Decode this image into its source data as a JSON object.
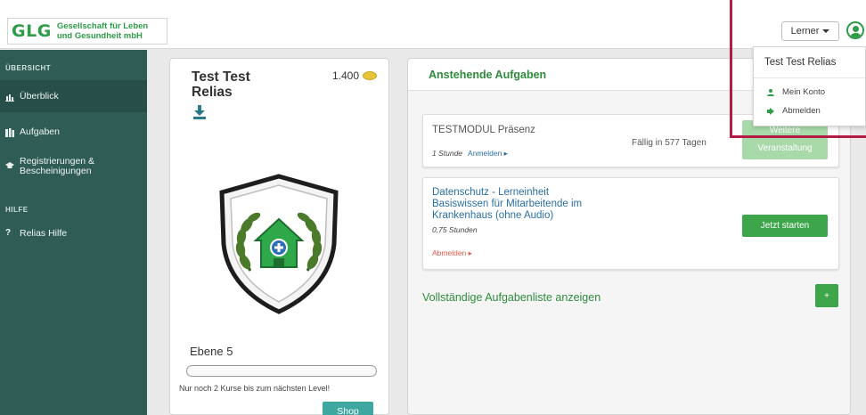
{
  "header": {
    "logo_mark": "GLG",
    "logo_line1": "Gesellschaft für Leben",
    "logo_line2": "und Gesundheit mbH",
    "role_button": "Lerner"
  },
  "sidebar": {
    "section_overview": "ÜBERSICHT",
    "items": [
      {
        "label": "Überblick",
        "icon": "bar-chart-icon"
      },
      {
        "label": "Aufgaben",
        "icon": "books-icon"
      },
      {
        "label_line1": "Registrierungen &",
        "label_line2": "Bescheinigungen",
        "icon": "graduation-cap-icon"
      }
    ],
    "section_help": "HILFE",
    "help_item": {
      "label": "Relias Hilfe",
      "icon": "question-icon"
    }
  },
  "profile_card": {
    "name_line1": "Test Test",
    "name_line2": "Relias",
    "points": "1.400",
    "level": "Ebene 5",
    "progress_fraction": 0,
    "hint": "Nur noch 2 Kurse bis zum nächsten Level!",
    "shop_button": "Shop"
  },
  "tasks_panel": {
    "title": "Anstehende Aufgaben",
    "tasks": [
      {
        "title": "TESTMODUL Präsenz",
        "duration": "1 Stunde",
        "link": "Anmelden ▸",
        "due": "Fällig in 577 Tagen",
        "button_top": "Weitere",
        "button": "Veranstaltung"
      },
      {
        "title_line1": "Datenschutz - Lerneinheit",
        "title_line2": "Basiswissen für Mitarbeitende im",
        "title_line3": "Krankenhaus (ohne Audio)",
        "duration": "0,75 Stunden",
        "link": "Abmelden ▸",
        "button": "Jetzt starten"
      }
    ],
    "full_list_link": "Vollständige Aufgabenliste anzeigen",
    "plus_button": "+"
  },
  "user_dropdown": {
    "name": "Test Test Relias",
    "items": [
      {
        "label": "Mein Konto",
        "icon": "person-icon"
      },
      {
        "label": "Abmelden",
        "icon": "sign-out-icon"
      }
    ]
  },
  "colors": {
    "brand_green": "#2e9c48",
    "sidebar_bg": "#2f5d56",
    "annotation": "#b31c45",
    "shop_teal": "#3ea7a0"
  }
}
